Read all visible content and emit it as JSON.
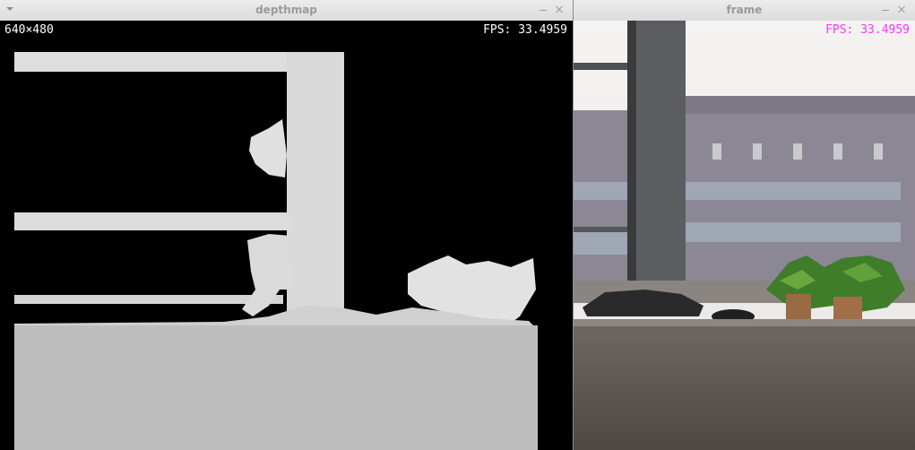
{
  "windows": {
    "depthmap": {
      "title": "depthmap",
      "resolution_label": "640×480",
      "fps_label": "FPS: 33.4959",
      "controls": {
        "minimize": "minimize-icon",
        "close": "close-icon"
      }
    },
    "frame": {
      "title": "frame",
      "fps_label": "FPS: 33.4959",
      "fps_color": "#ff33ff",
      "controls": {
        "minimize": "minimize-icon",
        "close": "close-icon"
      }
    }
  },
  "colors": {
    "titlebar": "#e4e4e4",
    "depth_background": "#000000",
    "depth_near": "#d8d8d8",
    "depth_far": "#bdbdbd"
  }
}
